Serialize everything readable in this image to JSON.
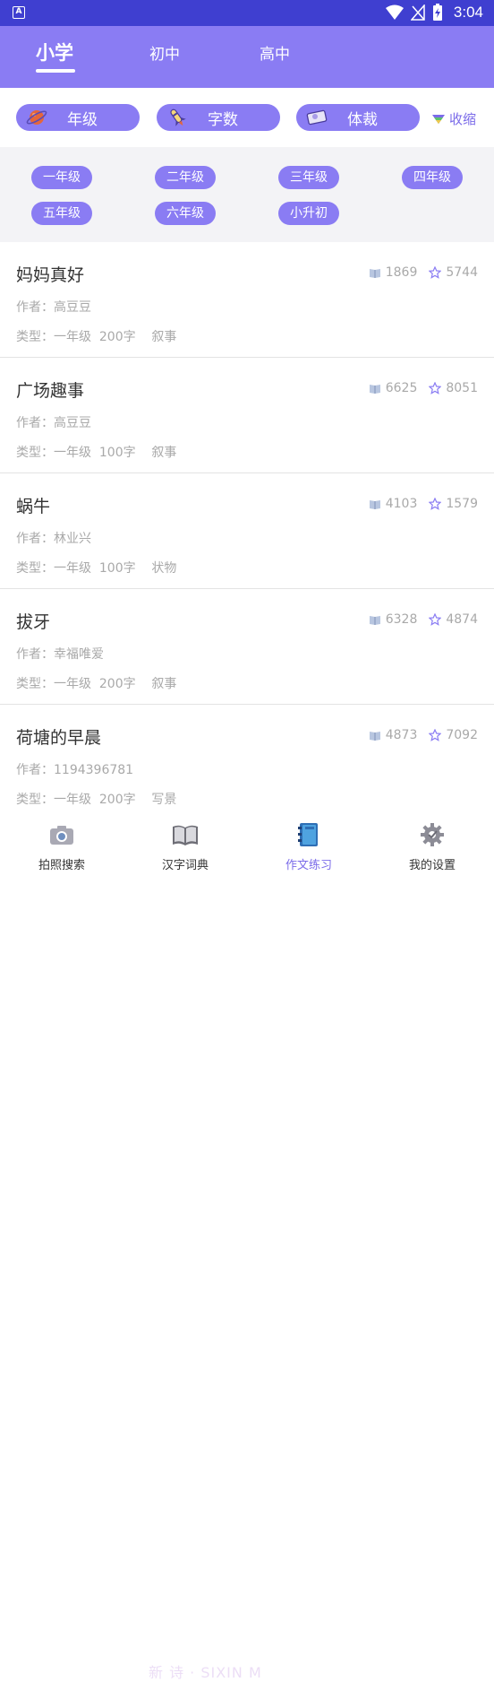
{
  "status_bar": {
    "time": "3:04"
  },
  "tabs": [
    {
      "label": "小学",
      "active": true
    },
    {
      "label": "初中",
      "active": false
    },
    {
      "label": "高中",
      "active": false
    }
  ],
  "filters": {
    "grade_label": "年级",
    "words_label": "字数",
    "genre_label": "体裁",
    "collapse_label": "收缩"
  },
  "grades": [
    "一年级",
    "二年级",
    "三年级",
    "四年级",
    "五年级",
    "六年级",
    "小升初"
  ],
  "articles": [
    {
      "title": "妈妈真好",
      "author": "作者：高豆豆",
      "meta": "类型：一年级  200字    叙事",
      "reads": "1869",
      "stars": "5744"
    },
    {
      "title": "广场趣事",
      "author": "作者：高豆豆",
      "meta": "类型：一年级  100字    叙事",
      "reads": "6625",
      "stars": "8051"
    },
    {
      "title": "蜗牛",
      "author": "作者：林业兴",
      "meta": "类型：一年级  100字    状物",
      "reads": "4103",
      "stars": "1579"
    },
    {
      "title": "拔牙",
      "author": "作者：幸福唯爱",
      "meta": "类型：一年级  200字    叙事",
      "reads": "6328",
      "stars": "4874"
    },
    {
      "title": "荷塘的早晨",
      "author": "作者：1194396781",
      "meta": "类型：一年级  200字    写景",
      "reads": "4873",
      "stars": "7092"
    }
  ],
  "bottom_nav": [
    {
      "label": "拍照搜索",
      "icon": "camera-icon",
      "active": false
    },
    {
      "label": "汉字词典",
      "icon": "book-icon",
      "active": false
    },
    {
      "label": "作文练习",
      "icon": "notebook-icon",
      "active": true
    },
    {
      "label": "我的设置",
      "icon": "gear-icon",
      "active": false
    }
  ],
  "watermark": "新  诗 · SIXIN  M",
  "colors": {
    "status_bar": "#3F3FD0",
    "header": "#8A7CF3",
    "accent": "#7B6BE9",
    "grade_panel": "#F3F3F6"
  }
}
